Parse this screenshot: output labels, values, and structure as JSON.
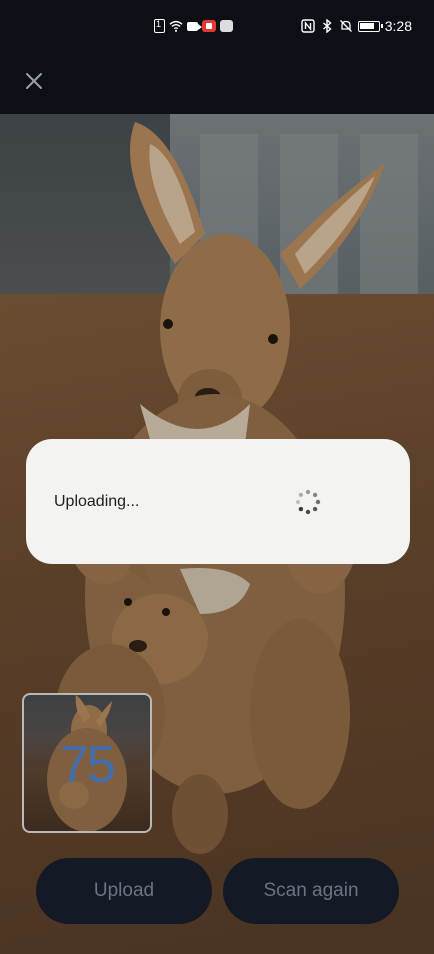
{
  "status_bar": {
    "time": "3:28",
    "icons_left": [
      "sim-icon",
      "wifi-icon",
      "video-camera-icon",
      "screen-record-icon",
      "app-icon"
    ],
    "icons_right": [
      "nfc-icon",
      "bluetooth-icon",
      "mute-bell-icon",
      "battery-icon"
    ]
  },
  "header": {
    "close_icon": "close-icon"
  },
  "dialog": {
    "message": "Uploading...",
    "spinner_icon": "loading-spinner-icon"
  },
  "thumbnail": {
    "count": "75"
  },
  "actions": {
    "upload_label": "Upload",
    "scan_again_label": "Scan again"
  },
  "colors": {
    "background": "#0c0f15",
    "button_bg": "#131a26",
    "button_text": "#6b7485",
    "dialog_bg": "#f3f3f1",
    "count_color": "#3d70b8"
  }
}
